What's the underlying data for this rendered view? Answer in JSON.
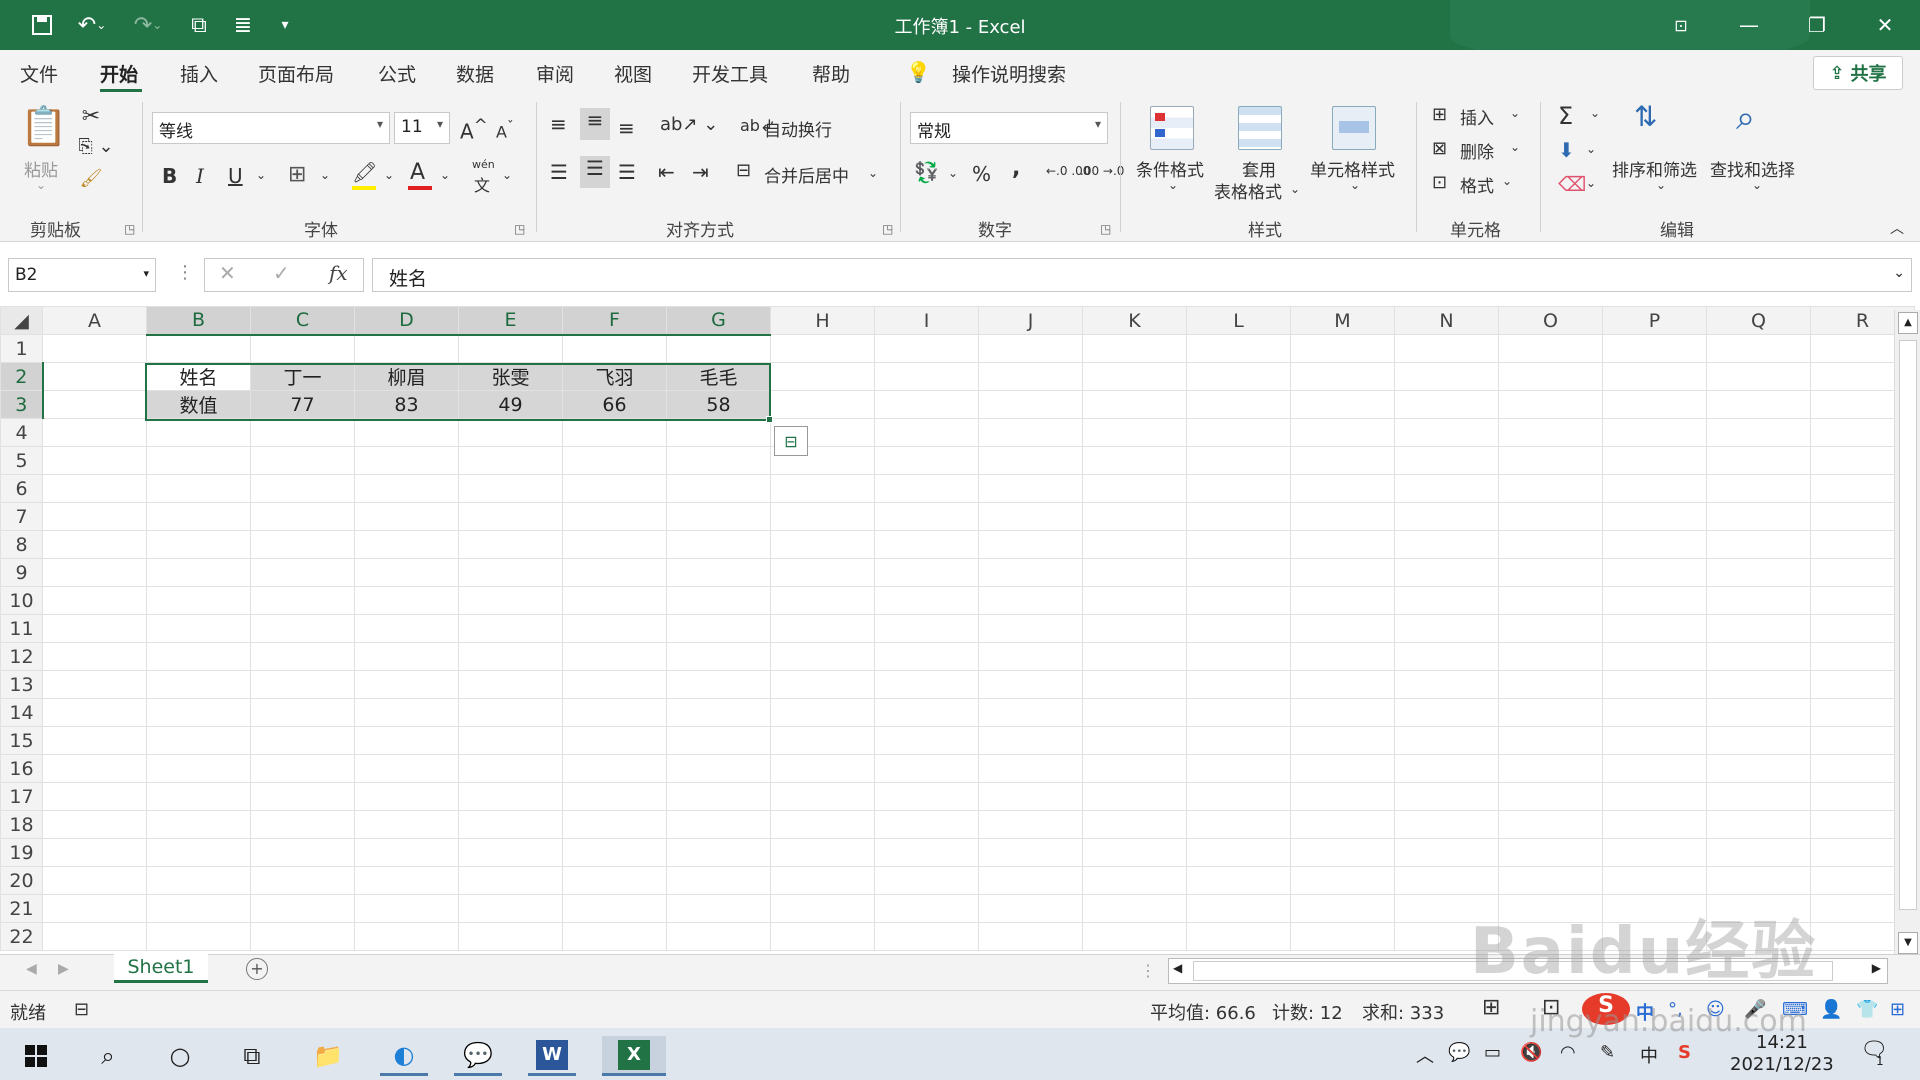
{
  "app": {
    "title": "工作簿1  -  Excel",
    "accent": "#217346"
  },
  "ribbon_tabs": [
    "文件",
    "开始",
    "插入",
    "页面布局",
    "公式",
    "数据",
    "审阅",
    "视图",
    "开发工具",
    "帮助"
  ],
  "active_tab": "开始",
  "tell_me": "操作说明搜索",
  "share": "共享",
  "clipboard": {
    "paste": "粘贴",
    "label": "剪贴板"
  },
  "font": {
    "name": "等线",
    "size": "11",
    "label": "字体",
    "bold": "B",
    "italic": "I",
    "underline": "U",
    "grow": "A",
    "shrink": "A",
    "color_letter": "A",
    "phonetic": "wén"
  },
  "alignment": {
    "wrap": "自动换行",
    "merge": "合并后居中",
    "label": "对齐方式"
  },
  "number": {
    "format": "常规",
    "percent": "%",
    "comma": ",",
    "inc": "←.0 .00",
    "dec": ".00 →.0",
    "label": "数字"
  },
  "styles": {
    "conditional": "条件格式",
    "table_line1": "套用",
    "table_line2": "表格格式",
    "cell_styles": "单元格样式",
    "label": "样式"
  },
  "cells": {
    "insert": "插入",
    "delete": "删除",
    "format": "格式",
    "label": "单元格"
  },
  "editing": {
    "sum": "Σ",
    "sort": "排序和筛选",
    "find": "查找和选择",
    "label": "编辑"
  },
  "formula_bar": {
    "name_box": "B2",
    "fx": "fx",
    "content": "姓名"
  },
  "columns": [
    "A",
    "B",
    "C",
    "D",
    "E",
    "F",
    "G",
    "H",
    "I",
    "J",
    "K",
    "L",
    "M",
    "N",
    "O",
    "P",
    "Q",
    "R"
  ],
  "rows": [
    "1",
    "2",
    "3",
    "4",
    "5",
    "6",
    "7",
    "8",
    "9",
    "10",
    "11",
    "12",
    "13",
    "14",
    "15",
    "16",
    "17",
    "18",
    "19",
    "20",
    "21",
    "22"
  ],
  "cells_data": {
    "row2": [
      "姓名",
      "丁一",
      "柳眉",
      "张雯",
      "飞羽",
      "毛毛"
    ],
    "row3": [
      "数值",
      "77",
      "83",
      "49",
      "66",
      "58"
    ]
  },
  "sheet_tabs": [
    "Sheet1"
  ],
  "status": {
    "ready": "就绪",
    "average": "平均值: 66.6",
    "count": "计数: 12",
    "sum": "求和: 333"
  },
  "taskbar": {
    "time": "14:21",
    "date": "2021/12/23",
    "ime": "中",
    "notifications": "1"
  },
  "watermark": {
    "brand": "Baidu经验",
    "url": "jingyan.baidu.com"
  }
}
